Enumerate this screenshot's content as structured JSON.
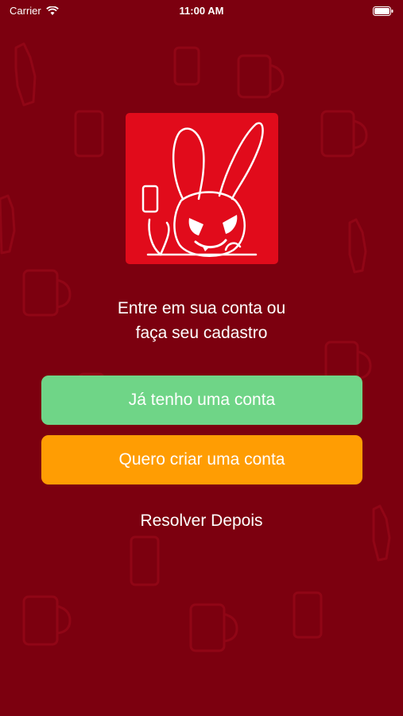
{
  "status_bar": {
    "carrier": "Carrier",
    "time": "11:00 AM"
  },
  "logo": {
    "icon": "bunny-mascot-icon",
    "background_color": "#e10b1b"
  },
  "subtitle": {
    "line1": "Entre em sua conta ou",
    "line2": "faça seu cadastro"
  },
  "buttons": {
    "login_label": "Já tenho uma conta",
    "signup_label": "Quero criar uma conta",
    "later_label": "Resolver Depois"
  },
  "colors": {
    "background": "#7c000f",
    "login_button": "#6fd587",
    "signup_button": "#ff9d03"
  }
}
